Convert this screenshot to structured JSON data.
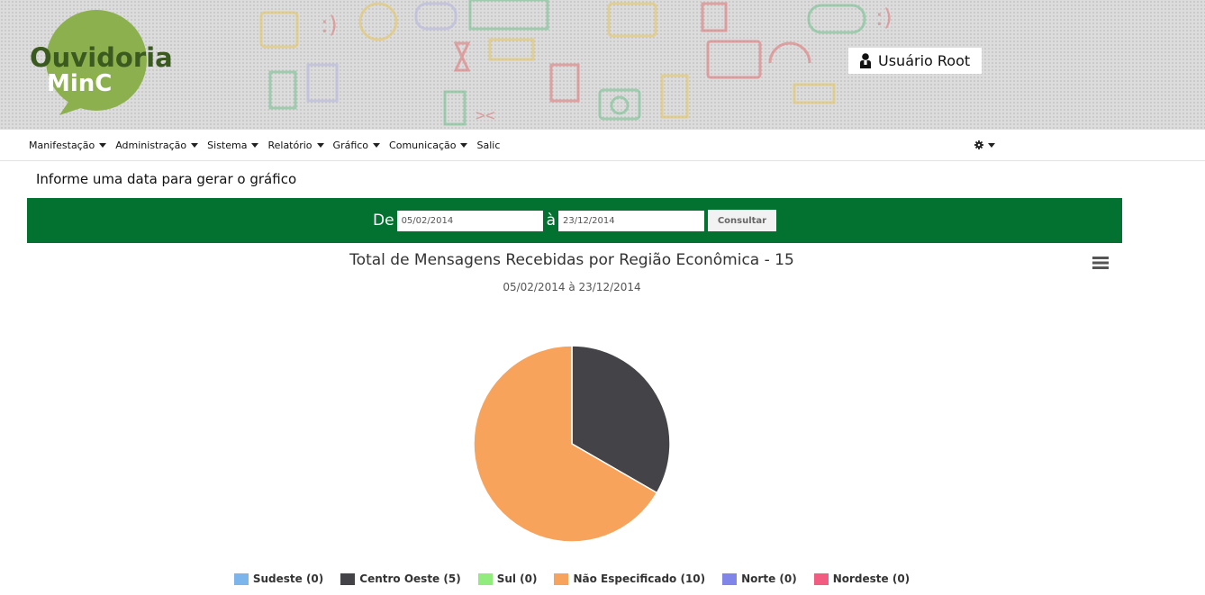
{
  "header": {
    "logo_line1": "Ouvidoria",
    "logo_line2": "MinC",
    "user_name": "Usuário Root"
  },
  "nav": {
    "items": [
      {
        "label": "Manifestação",
        "dropdown": true
      },
      {
        "label": "Administração",
        "dropdown": true
      },
      {
        "label": "Sistema",
        "dropdown": true
      },
      {
        "label": "Relatório",
        "dropdown": true
      },
      {
        "label": "Gráfico",
        "dropdown": true
      },
      {
        "label": "Comunicação",
        "dropdown": true
      },
      {
        "label": "Salic",
        "dropdown": false
      }
    ],
    "settings_icon": "gear-icon"
  },
  "filter": {
    "prompt": "Informe uma data para gerar o gráfico",
    "from_label": "De",
    "from_value": "05/02/2014",
    "to_label": "à",
    "to_value": "23/12/2014",
    "submit_label": "Consultar"
  },
  "chart_data": {
    "type": "pie",
    "title": "Total de Mensagens Recebidas por Região Econômica - 15",
    "subtitle": "05/02/2014 à 23/12/2014",
    "legend_position": "bottom",
    "series": [
      {
        "name": "Sudeste",
        "value": 0,
        "label": "Sudeste (0)",
        "color": "#7cb5ec"
      },
      {
        "name": "Centro Oeste",
        "value": 5,
        "label": "Centro Oeste (5)",
        "color": "#434348"
      },
      {
        "name": "Sul",
        "value": 0,
        "label": "Sul (0)",
        "color": "#90ed7d"
      },
      {
        "name": "Não Especificado",
        "value": 10,
        "label": "Não Especificado (10)",
        "color": "#f7a35c"
      },
      {
        "name": "Norte",
        "value": 0,
        "label": "Norte (0)",
        "color": "#8085e9"
      },
      {
        "name": "Nordeste",
        "value": 0,
        "label": "Nordeste (0)",
        "color": "#f15c80"
      }
    ]
  },
  "colors": {
    "brand_green": "#037230",
    "logo_green": "#8db04e",
    "logo_text": "#3b5a1f"
  }
}
